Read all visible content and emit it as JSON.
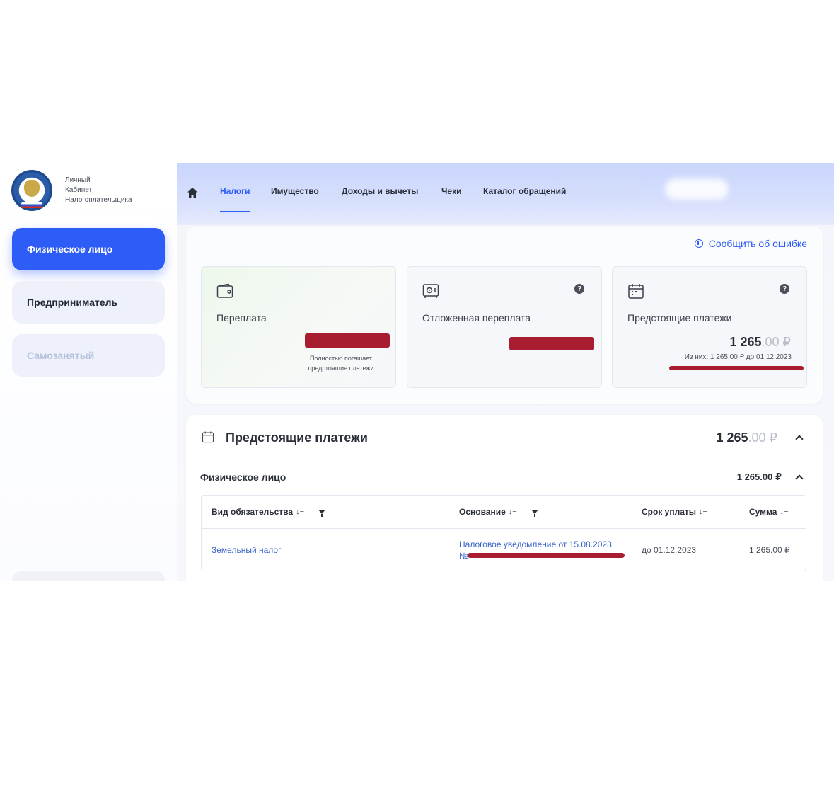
{
  "sidebar": {
    "logo_text": [
      "Личный",
      "Кабинет",
      "Налогоплательщика"
    ],
    "items": [
      {
        "label": "Физическое лицо"
      },
      {
        "label": "Предприниматель"
      },
      {
        "label": "Самозанятый"
      }
    ]
  },
  "nav": {
    "tabs": [
      {
        "label": "Налоги"
      },
      {
        "label": "Имущество"
      },
      {
        "label": "Доходы и вычеты"
      },
      {
        "label": "Чеки"
      },
      {
        "label": "Каталог обращений"
      }
    ]
  },
  "summary": {
    "report_label": "Сообщить об ошибке",
    "cards": [
      {
        "label": "Переплата",
        "note": "Полностью погашает предстоящие платежи",
        "icon": "wallet-icon"
      },
      {
        "label": "Отложенная переплата",
        "icon": "safe-icon"
      },
      {
        "label": "Предстоящие платежи",
        "amount_int": "1 265",
        "amount_dec": ".00 ₽",
        "sub": "Из них: 1 265.00 ₽ до 01.12.2023",
        "icon": "calendar-icon"
      }
    ]
  },
  "payments": {
    "title": "Предстоящие платежи",
    "amount_int": "1 265",
    "amount_dec": ".00 ₽",
    "group": {
      "title": "Физическое лицо",
      "amount": "1 265.00 ₽"
    },
    "columns": [
      "Вид обязательства",
      "Основание",
      "Срок уплаты",
      "Сумма"
    ],
    "rows": [
      {
        "type": "Земельный налог",
        "basis_line1": "Налоговое уведомление от 15.08.2023",
        "basis_line2": "№",
        "due": "до 01.12.2023",
        "sum": "1 265.00 ₽"
      }
    ]
  },
  "colors": {
    "accent": "#2d5cf6",
    "redaction": "#a81d2f"
  }
}
